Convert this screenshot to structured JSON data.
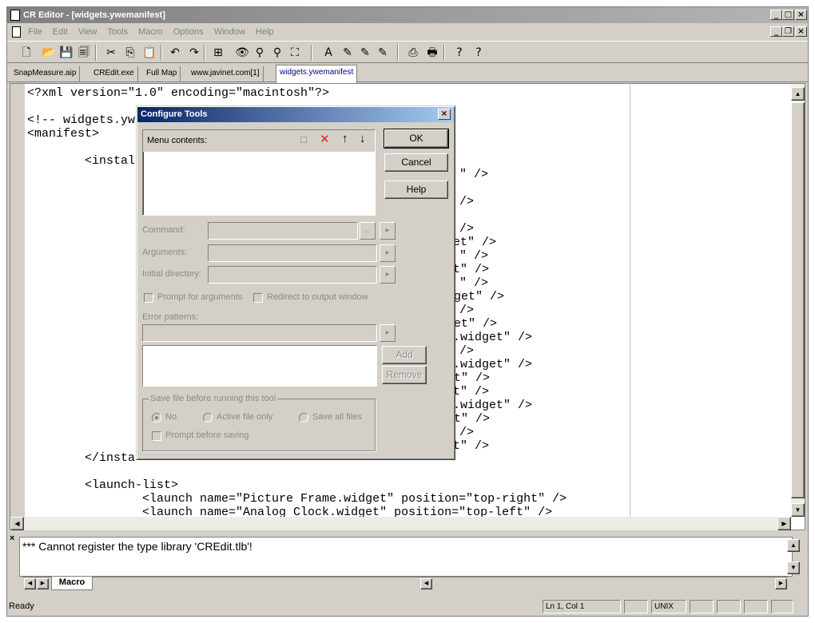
{
  "window": {
    "title": "CR Editor - [widgets.ywemanifest]",
    "min_glyph": "_",
    "max_glyph": "□",
    "close_glyph": "×",
    "restore_glyph": "❐"
  },
  "menu": [
    "File",
    "Edit",
    "View",
    "Tools",
    "Macro",
    "Options",
    "Window",
    "Help"
  ],
  "toolbar": {
    "icons": [
      "new-file-icon",
      "open-folder-icon",
      "save-icon",
      "save-all-icon",
      "cut-icon",
      "copy-icon",
      "paste-icon",
      "undo-icon",
      "redo-icon",
      "project-icon",
      "find-icon",
      "find-next-icon",
      "find-prev-icon",
      "replace-icon",
      "tool-a-icon",
      "tool-b-icon",
      "tool-c-icon",
      "tool-d-icon",
      "print-icon",
      "print-preview-icon",
      "help-icon",
      "context-help-icon"
    ],
    "glyphs": [
      "🗋",
      "📂",
      "💾",
      "🗐",
      "✂",
      "⎘",
      "📋",
      "↶",
      "↷",
      "⊞",
      "👁",
      "⚲",
      "⚲",
      "⛶",
      "A",
      "✎",
      "✎",
      "✎",
      "⎙",
      "🖶",
      "?",
      "?"
    ]
  },
  "file_tabs": [
    "SnapMeasure.aip",
    "CREdit.exe",
    "Full Map",
    "www.javinet.com[1]",
    "widgets.ywemanifest"
  ],
  "editor": {
    "lines": [
      "<?xml version=\"1.0\" encoding=\"macintosh\"?>",
      "<!-- widgets.yw",
      "<manifest>",
      "        <instal",
      "\" />",
      "/>",
      "/>",
      "et\" />",
      "\" />",
      "t\" />",
      "\" />",
      "dget\" />",
      "/>",
      "get\" />",
      ".widget\" />",
      "/>",
      ".widget\" />",
      "et\" />",
      "t\" />",
      ".widget\" />",
      "et\" />",
      "/>",
      "t\" />",
      "        </insta",
      "        <launch-list>",
      "                <launch name=\"Picture Frame.widget\" position=\"top-right\" />",
      "                <launch name=\"Analog Clock.widget\" position=\"top-left\" />"
    ]
  },
  "output": {
    "message": "*** Cannot register the type library 'CREdit.tlb'!",
    "tab_label": "Macro",
    "close_glyph": "×"
  },
  "status": {
    "ready": "Ready",
    "position": "Ln 1, Col 1",
    "format": "UNIX"
  },
  "dialog": {
    "title": "Configure Tools",
    "close_glyph": "×",
    "menu_contents_label": "Menu contents:",
    "ok": "OK",
    "cancel": "Cancel",
    "help": "Help",
    "command_label": "Command:",
    "arguments_label": "Arguments:",
    "initial_directory_label": "Initial directory:",
    "browse_glyph": "...",
    "arrow_glyph": "▸",
    "prompt_args_label": "Prompt for arguments",
    "redirect_label": "Redirect to output window",
    "error_patterns_label": "Error patterns:",
    "add": "Add",
    "remove": "Remove",
    "save_group_label": "Save file before running this tool",
    "radio_no": "No",
    "radio_active": "Active file only",
    "radio_all": "Save all files",
    "prompt_saving_label": "Prompt before saving"
  }
}
